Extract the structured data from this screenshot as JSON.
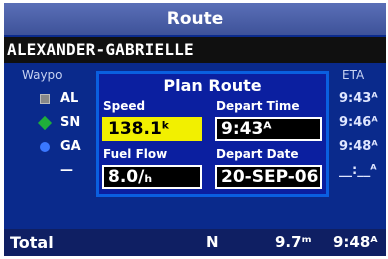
{
  "window": {
    "title": "Route"
  },
  "route": {
    "name": "ALEXANDER-GABRIELLE"
  },
  "columns": {
    "waypoint": "Waypo",
    "eta": "ETA"
  },
  "rows": [
    {
      "icon": "waypoint-square-icon",
      "name": "AL",
      "eta": "9:43ᴬ"
    },
    {
      "icon": "waypoint-diamond-icon",
      "name": "SN",
      "eta": "9:46ᴬ"
    },
    {
      "icon": "waypoint-circle-icon",
      "name": "GA",
      "eta": "9:48ᴬ"
    }
  ],
  "empty_row": {
    "name": "—",
    "eta": "__:__ᴬ"
  },
  "total": {
    "label": "Total",
    "direction": "N",
    "distance": "9.7ᵐ",
    "eta": "9:48ᴬ"
  },
  "plan_route": {
    "title": "Plan Route",
    "speed": {
      "label": "Speed",
      "value": "138.1ᵏ"
    },
    "depart_time": {
      "label": "Depart Time",
      "value": "9:43ᴬ"
    },
    "fuel_flow": {
      "label": "Fuel Flow",
      "value": "8.0/ₕ"
    },
    "depart_date": {
      "label": "Depart Date",
      "value": "20-SEP-06"
    }
  },
  "colors": {
    "background": "#0a2a8c",
    "highlight": "#f2f000",
    "dialog": "#0b1fa0"
  }
}
